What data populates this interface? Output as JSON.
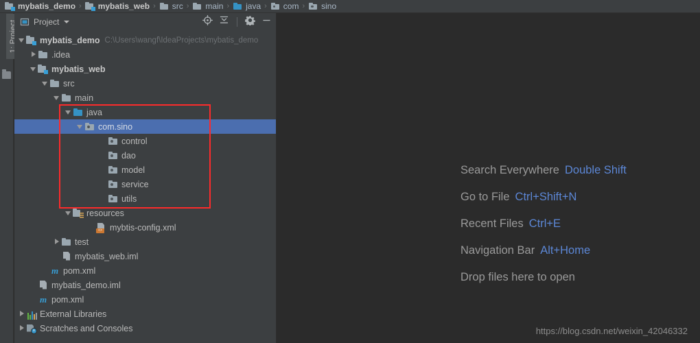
{
  "breadcrumb": {
    "name": "navigation-breadcrumb",
    "separator": "›",
    "items": [
      {
        "label": "mybatis_demo",
        "icon": "module-icon",
        "bold": true
      },
      {
        "label": "mybatis_web",
        "icon": "module-icon",
        "bold": true
      },
      {
        "label": "src",
        "icon": "folder-icon",
        "bold": false
      },
      {
        "label": "main",
        "icon": "folder-icon",
        "bold": false
      },
      {
        "label": "java",
        "icon": "source-folder-icon",
        "bold": false
      },
      {
        "label": "com",
        "icon": "package-icon",
        "bold": false
      },
      {
        "label": "sino",
        "icon": "package-icon",
        "bold": false
      }
    ]
  },
  "stripe": {
    "tab_label": "1: Project"
  },
  "tool_window": {
    "title": "Project",
    "actions": [
      {
        "name": "select-opened-file-icon",
        "tooltip": "Select Opened File"
      },
      {
        "name": "collapse-all-icon",
        "tooltip": "Collapse All"
      },
      {
        "name": "settings-gear-icon",
        "tooltip": "Settings"
      },
      {
        "name": "hide-icon",
        "tooltip": "Hide"
      }
    ]
  },
  "tree": {
    "rows": [
      {
        "label": "mybatis_demo",
        "secondary": "C:\\Users\\wangf\\IdeaProjects\\mybatis_demo",
        "indent": 0,
        "arrow": "down",
        "icon": "module-icon",
        "bold": true,
        "selected": false
      },
      {
        "label": ".idea",
        "secondary": "",
        "indent": 1,
        "arrow": "right",
        "icon": "folder-icon",
        "bold": false,
        "selected": false
      },
      {
        "label": "mybatis_web",
        "secondary": "",
        "indent": 1,
        "arrow": "down",
        "icon": "module-icon",
        "bold": true,
        "selected": false
      },
      {
        "label": "src",
        "secondary": "",
        "indent": 2,
        "arrow": "down",
        "icon": "folder-icon",
        "bold": false,
        "selected": false
      },
      {
        "label": "main",
        "secondary": "",
        "indent": 3,
        "arrow": "down",
        "icon": "folder-icon",
        "bold": false,
        "selected": false
      },
      {
        "label": "java",
        "secondary": "",
        "indent": 4,
        "arrow": "down",
        "icon": "source-folder-icon",
        "bold": false,
        "selected": false
      },
      {
        "label": "com.sino",
        "secondary": "",
        "indent": 5,
        "arrow": "down",
        "icon": "package-icon",
        "bold": false,
        "selected": true
      },
      {
        "label": "control",
        "secondary": "",
        "indent": 7,
        "arrow": "none",
        "icon": "package-icon",
        "bold": false,
        "selected": false
      },
      {
        "label": "dao",
        "secondary": "",
        "indent": 7,
        "arrow": "none",
        "icon": "package-icon",
        "bold": false,
        "selected": false
      },
      {
        "label": "model",
        "secondary": "",
        "indent": 7,
        "arrow": "none",
        "icon": "package-icon",
        "bold": false,
        "selected": false
      },
      {
        "label": "service",
        "secondary": "",
        "indent": 7,
        "arrow": "none",
        "icon": "package-icon",
        "bold": false,
        "selected": false
      },
      {
        "label": "utils",
        "secondary": "",
        "indent": 7,
        "arrow": "none",
        "icon": "package-icon",
        "bold": false,
        "selected": false
      },
      {
        "label": "resources",
        "secondary": "",
        "indent": 4,
        "arrow": "down",
        "icon": "resources-folder-icon",
        "bold": false,
        "selected": false
      },
      {
        "label": "mybtis-config.xml",
        "secondary": "",
        "indent": 6,
        "arrow": "none",
        "icon": "xml-file-icon",
        "bold": false,
        "selected": false
      },
      {
        "label": "test",
        "secondary": "",
        "indent": 3,
        "arrow": "right",
        "icon": "folder-icon",
        "bold": false,
        "selected": false
      },
      {
        "label": "mybatis_web.iml",
        "secondary": "",
        "indent": 3,
        "arrow": "none",
        "icon": "iml-file-icon",
        "bold": false,
        "selected": false
      },
      {
        "label": "pom.xml",
        "secondary": "",
        "indent": 2,
        "arrow": "none",
        "icon": "maven-file-icon",
        "bold": false,
        "selected": false
      },
      {
        "label": "mybatis_demo.iml",
        "secondary": "",
        "indent": 1,
        "arrow": "none",
        "icon": "iml-file-icon",
        "bold": false,
        "selected": false
      },
      {
        "label": "pom.xml",
        "secondary": "",
        "indent": 1,
        "arrow": "none",
        "icon": "maven-file-icon",
        "bold": false,
        "selected": false
      },
      {
        "label": "External Libraries",
        "secondary": "",
        "indent": 0,
        "arrow": "right",
        "icon": "libraries-icon",
        "bold": false,
        "selected": false
      },
      {
        "label": "Scratches and Consoles",
        "secondary": "",
        "indent": 0,
        "arrow": "right",
        "icon": "scratches-icon",
        "bold": false,
        "selected": false
      }
    ]
  },
  "annotation": {
    "name": "red-highlight-box",
    "color": "#fd2b2b"
  },
  "editor": {
    "hints": [
      {
        "action": "Search Everywhere",
        "shortcut": "Double Shift"
      },
      {
        "action": "Go to File",
        "shortcut": "Ctrl+Shift+N"
      },
      {
        "action": "Recent Files",
        "shortcut": "Ctrl+E"
      },
      {
        "action": "Navigation Bar",
        "shortcut": "Alt+Home"
      },
      {
        "action": "Drop files here to open",
        "shortcut": ""
      }
    ],
    "watermark": "https://blog.csdn.net/weixin_42046332"
  },
  "colors": {
    "panel_bg": "#3c3f41",
    "editor_bg": "#2b2b2b",
    "selection": "#4b6eaf",
    "accent_link": "#5c87d6",
    "source_root": "#3592c4",
    "annotation": "#fd2b2b"
  }
}
